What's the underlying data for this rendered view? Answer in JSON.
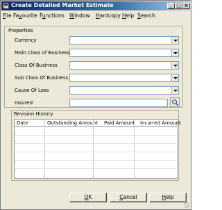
{
  "window": {
    "title": "Create Detailed Market Estimate"
  },
  "menu": [
    {
      "label": "File",
      "u": "F",
      "rest": "ile"
    },
    {
      "label": "Favourite",
      "u": "",
      "pre": "Fa",
      "u2": "v",
      "rest": "ourite"
    },
    {
      "label": "Functions",
      "u": "u",
      "pre": "F",
      "rest": "nctions"
    },
    {
      "label": "Window",
      "u": "W",
      "rest": "indow"
    },
    {
      "label": "Hardcopy",
      "u": "H",
      "rest": "ardcopy"
    },
    {
      "label": "Help",
      "u": "H",
      "rest": "elp"
    },
    {
      "label": "Search",
      "u": "S",
      "rest": "earch"
    }
  ],
  "properties": {
    "legend": "Properties",
    "fields": [
      {
        "label": "Currency",
        "value": ""
      },
      {
        "label": "Main Class of Business",
        "value": ""
      },
      {
        "label": "Class Of Business",
        "value": ""
      },
      {
        "label": "Sub Class Of Business",
        "value": ""
      },
      {
        "label": "Cause Of Loss",
        "value": ""
      }
    ],
    "insured": {
      "label": "Insured",
      "value": ""
    }
  },
  "revision_history": {
    "caption": "Revision History",
    "columns": [
      "Date",
      "Outstanding Amount",
      "Paid Amount",
      "Incurred Amount"
    ],
    "rows": []
  },
  "buttons": {
    "ok": {
      "u": "O",
      "rest": "K"
    },
    "cancel": {
      "u": "C",
      "rest": "ancel"
    },
    "help": {
      "u": "H",
      "rest": "elp"
    }
  }
}
